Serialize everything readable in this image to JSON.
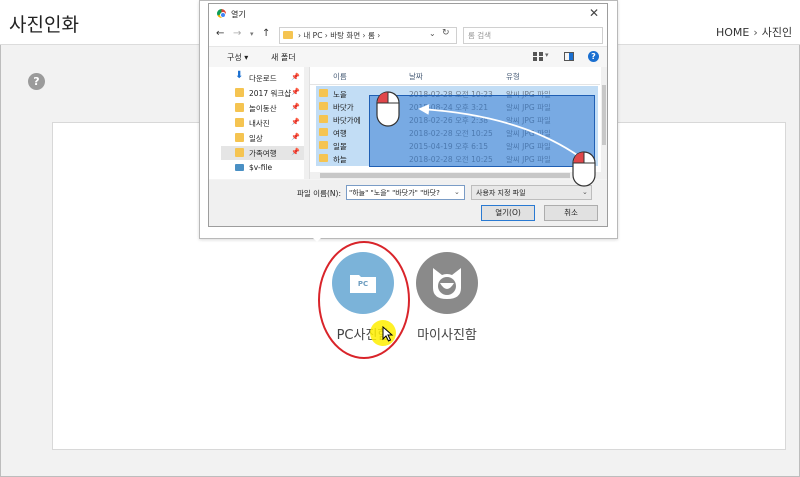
{
  "page": {
    "title": "사진인화",
    "breadcrumb": [
      "HOME",
      "사진인"
    ],
    "breadcrumb_separator": "›",
    "help_label": "?"
  },
  "options": {
    "pc": {
      "label": "PC사진함",
      "icon_text": "PC",
      "icon": "folder-icon",
      "color": "#7bb3d9"
    },
    "my": {
      "label": "마이사진함",
      "icon": "cat-icon",
      "color": "#8a8a8a"
    }
  },
  "dialog": {
    "title": "열기",
    "close": "✕",
    "nav": {
      "back": "←",
      "forward": "→",
      "up": "↑"
    },
    "address": {
      "path": "› 내 PC › 바탕 화면 › 롬 ›"
    },
    "search_placeholder": "롬 검색",
    "toolbar": {
      "organize": "구성 ▾",
      "new_folder": "새 폴더",
      "help": "?"
    },
    "nav_pane": [
      {
        "label": "다운로드",
        "icon": "download-icon",
        "pinned": true
      },
      {
        "label": "2017 워크샵",
        "icon": "folder-icon",
        "pinned": true
      },
      {
        "label": "놀이동산",
        "icon": "folder-icon",
        "pinned": true
      },
      {
        "label": "내사진",
        "icon": "folder-icon",
        "pinned": true
      },
      {
        "label": "일상",
        "icon": "folder-icon",
        "pinned": true
      },
      {
        "label": "가족여행",
        "icon": "folder-icon",
        "pinned": true,
        "selected": true
      },
      {
        "label": "$v-file",
        "icon": "pc-icon",
        "pinned": false
      }
    ],
    "columns": {
      "name": "이름",
      "date": "날짜",
      "type": "유형"
    },
    "files": [
      {
        "name": "노을",
        "date": "2018-02-28 오전 10:23",
        "type": "알씨 JPG 파일"
      },
      {
        "name": "바닷가",
        "date": "2015-08-24 오후 3:21",
        "type": "알씨 JPG 파일"
      },
      {
        "name": "바닷가에",
        "date": "2018-02-26 오후 2:38",
        "type": "알씨 JPG 파일"
      },
      {
        "name": "여행",
        "date": "2018-02-28 오전 10:25",
        "type": "알씨 JPG 파일"
      },
      {
        "name": "일몰",
        "date": "2015-04-19 오후 6:15",
        "type": "알씨 JPG 파일"
      },
      {
        "name": "하늘",
        "date": "2018-02-28 오전 10:25",
        "type": "알씨 JPG 파일"
      }
    ],
    "filename_label": "파일 이름(N):",
    "filename_value": "\"하늘\" \"노을\" \"바닷가\" \"바닷?",
    "filetype_value": "사용자 지정 파일",
    "open_button": "열기(O)",
    "cancel_button": "취소"
  },
  "colors": {
    "annotation_ring": "#d9242a",
    "cursor_highlight": "#ffee00",
    "selection": "#2d78d2"
  }
}
